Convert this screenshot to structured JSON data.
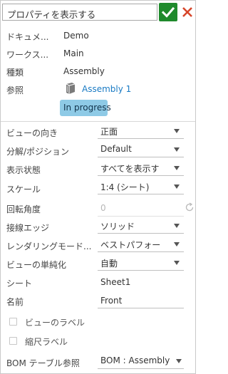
{
  "header": {
    "title": "プロパティを表示する",
    "ok_icon": "checkmark-icon",
    "cancel_icon": "close-icon",
    "ok_color": "#1f8a2c",
    "cancel_color": "#d6452a"
  },
  "info": {
    "document_label": "ドキュメ...",
    "document_value": "Demo",
    "workspace_label": "ワークス...",
    "workspace_value": "Main",
    "type_label": "種類",
    "type_value": "Assembly",
    "reference_label": "参照",
    "reference_value": "Assembly 1",
    "reference_icon": "assembly-icon",
    "status": "In progress"
  },
  "properties": {
    "view_orientation_label": "ビューの向き",
    "view_orientation_value": "正面",
    "explode_position_label": "分解/ポジション",
    "explode_position_value": "Default",
    "display_state_label": "表示状態",
    "display_state_value": "すべてを表示す",
    "scale_label": "スケール",
    "scale_value": "1:4 (シート)",
    "rotation_label": "回転角度",
    "rotation_value": "0",
    "tangent_edges_label": "接線エッジ",
    "tangent_edges_value": "ソリッド",
    "rendering_mode_label": "レンダリングモード...",
    "rendering_mode_value": "ベストパフォー",
    "simplification_label": "ビューの単純化",
    "simplification_value": "自動",
    "sheet_label": "シート",
    "sheet_value": "Sheet1",
    "name_label": "名前",
    "name_value": "Front",
    "view_label_checkbox": "ビューのラベル",
    "scale_label_checkbox": "縮尺ラベル",
    "bom_reference_label": "BOM テーブル参照",
    "bom_reference_value": "BOM : Assembly"
  },
  "colors": {
    "accent_link": "#1a7bc4",
    "status_badge": "#8ecae6"
  }
}
